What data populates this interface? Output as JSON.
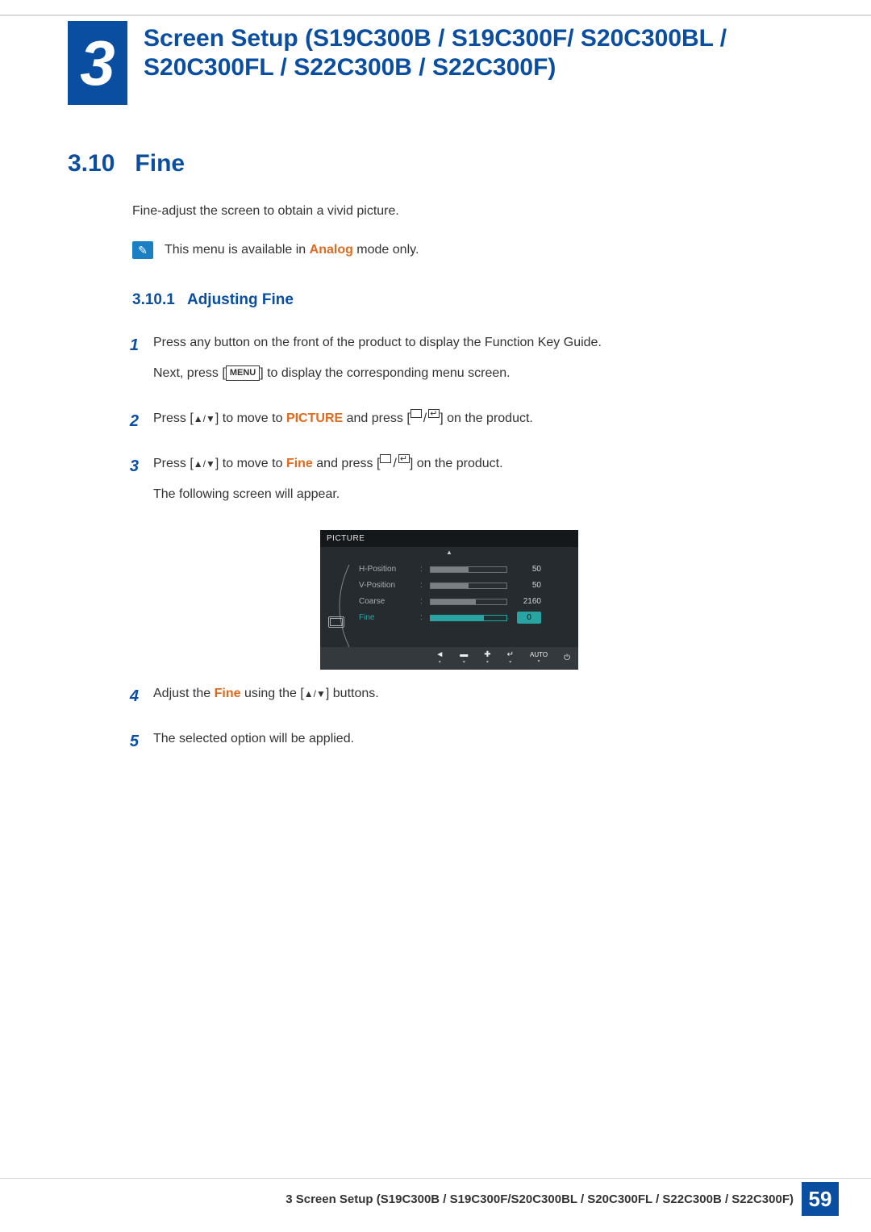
{
  "chapter": {
    "number": "3",
    "title": "Screen Setup (S19C300B / S19C300F/ S20C300BL / S20C300FL / S22C300B / S22C300F)"
  },
  "section": {
    "number": "3.10",
    "title": "Fine"
  },
  "intro": "Fine-adjust the screen to obtain a vivid picture.",
  "note": {
    "before": "This menu is available in ",
    "highlight": "Analog",
    "after": " mode only."
  },
  "sub": {
    "number": "3.10.1",
    "title": "Adjusting Fine"
  },
  "steps": {
    "s1": {
      "num": "1",
      "line1": "Press any button on the front of the product to display the Function Key Guide.",
      "line2_before": "Next, press [",
      "line2_btn": "MENU",
      "line2_after": "] to display the corresponding menu screen."
    },
    "s2": {
      "num": "2",
      "before": "Press [",
      "mid": "] to move to ",
      "target": "PICTURE",
      "after_target": " and press [",
      "tail": "] on the product."
    },
    "s3": {
      "num": "3",
      "before": "Press [",
      "mid": "] to move to ",
      "target": "Fine",
      "after_target": " and press [",
      "tail": "] on the product.",
      "line2": "The following screen will appear."
    },
    "s4": {
      "num": "4",
      "before": "Adjust the ",
      "target": "Fine",
      "mid": " using the [",
      "after": "] buttons."
    },
    "s5": {
      "num": "5",
      "text": "The selected option will be applied."
    }
  },
  "osd": {
    "title": "PICTURE",
    "rows": [
      {
        "label": "H-Position",
        "value": "50",
        "fillPct": 50,
        "active": false
      },
      {
        "label": "V-Position",
        "value": "50",
        "fillPct": 50,
        "active": false
      },
      {
        "label": "Coarse",
        "value": "2160",
        "fillPct": 60,
        "active": false
      },
      {
        "label": "Fine",
        "value": "0",
        "fillPct": 70,
        "active": true
      }
    ],
    "footer": {
      "back": "◄",
      "minus": "▬",
      "plus": "✚",
      "enter": "↵",
      "auto": "AUTO",
      "power": "⏻"
    }
  },
  "footer": {
    "text": "3 Screen Setup (S19C300B / S19C300F/S20C300BL / S20C300FL / S22C300B / S22C300F)",
    "page": "59"
  }
}
